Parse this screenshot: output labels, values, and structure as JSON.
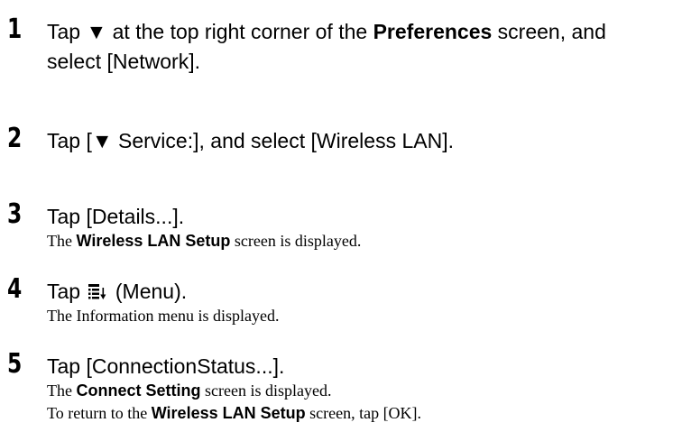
{
  "steps": [
    {
      "number": "1",
      "instruction": {
        "before": "Tap ▼ at the top right corner of the ",
        "bold": "Preferences",
        "after": " screen, and",
        "line2": "select [Network]."
      }
    },
    {
      "number": "2",
      "instruction": "Tap [▼ Service:], and select [Wireless LAN]."
    },
    {
      "number": "3",
      "instruction": "Tap [Details...].",
      "result": {
        "before": "The ",
        "bold": "Wireless LAN Setup",
        "after": " screen is displayed."
      }
    },
    {
      "number": "4",
      "instruction": {
        "before": "Tap ",
        "icon": "menu-icon",
        "after": " (Menu)."
      },
      "result": "The Information menu is displayed."
    },
    {
      "number": "5",
      "instruction": "Tap [ConnectionStatus...].",
      "result": {
        "before": "The ",
        "bold": "Connect Setting",
        "after": " screen is displayed."
      },
      "result2": {
        "before": "To return to the ",
        "bold": "Wireless LAN Setup",
        "after": " screen, tap [OK]."
      }
    }
  ]
}
